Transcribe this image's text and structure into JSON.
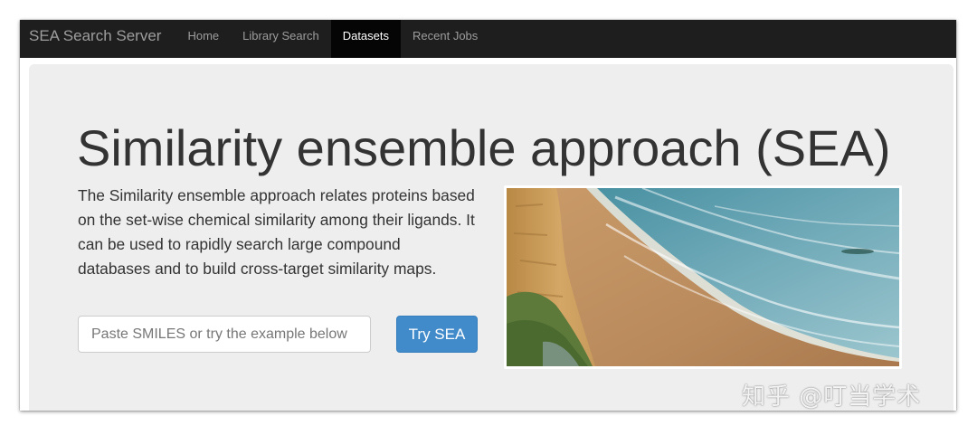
{
  "navbar": {
    "brand": "SEA Search Server",
    "items": [
      {
        "label": "Home",
        "active": false
      },
      {
        "label": "Library Search",
        "active": false
      },
      {
        "label": "Datasets",
        "active": true
      },
      {
        "label": "Recent Jobs",
        "active": false
      }
    ]
  },
  "hero": {
    "title": "Similarity ensemble approach (SEA)",
    "description": "The Similarity ensemble approach relates proteins based on the set-wise chemical similarity among their ligands. It can be used to rapidly search large compound databases and to build cross-target similarity maps.",
    "search": {
      "placeholder": "Paste SMILES or try the example below",
      "value": ""
    },
    "submit_label": "Try SEA",
    "image_subject": "coastal-cliff-beach-photo"
  },
  "watermark": "知乎 @叮当学术",
  "colors": {
    "navbar_bg": "#1e1e1e",
    "active_tab_bg": "#050505",
    "jumbotron_bg": "#eeeeee",
    "primary_button": "#428bca"
  }
}
